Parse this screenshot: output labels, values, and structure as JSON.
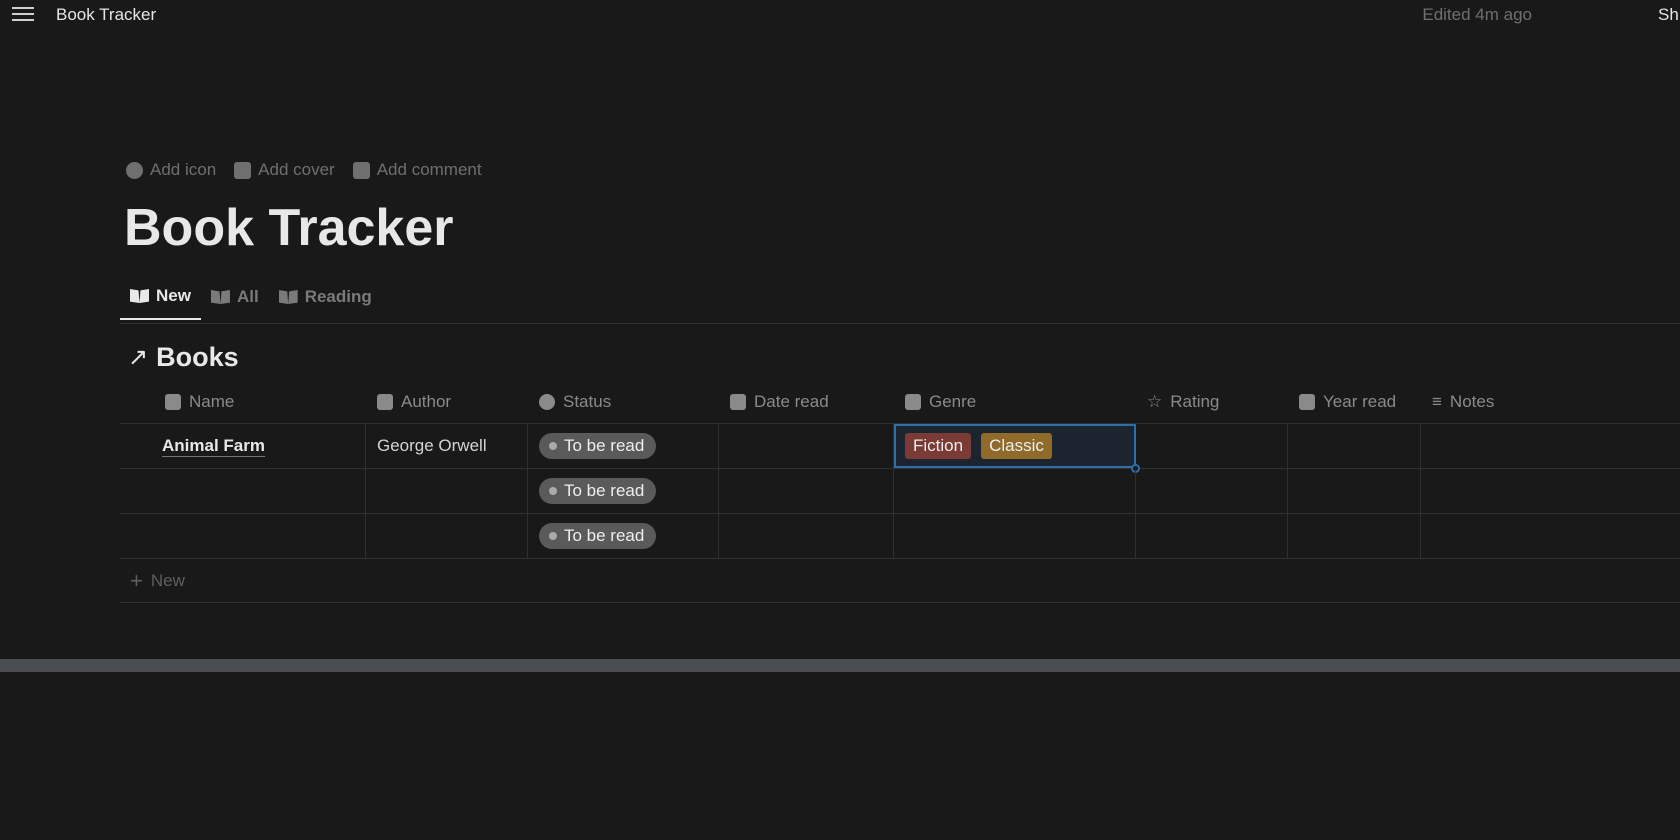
{
  "topbar": {
    "breadcrumb": "Book Tracker",
    "edited": "Edited 4m ago",
    "share": "Sh"
  },
  "page_actions": {
    "add_icon": "Add icon",
    "add_cover": "Add cover",
    "add_comment": "Add comment"
  },
  "title": "Book Tracker",
  "tabs": [
    {
      "label": "New",
      "active": true
    },
    {
      "label": "All"
    },
    {
      "label": "Reading"
    }
  ],
  "database": {
    "title": "Books",
    "arrow": "↗",
    "columns": [
      "Name",
      "Author",
      "Status",
      "Date read",
      "Genre",
      "Rating",
      "Year read",
      "Notes"
    ],
    "rows": [
      {
        "name": "Animal Farm",
        "author": "George Orwell",
        "status": "To be read",
        "genre": [
          {
            "label": "Fiction",
            "color": "#7a3a36"
          },
          {
            "label": "Classic",
            "color": "#8f6a2a"
          }
        ]
      },
      {
        "name": "",
        "author": "",
        "status": "To be read",
        "genre": []
      },
      {
        "name": "",
        "author": "",
        "status": "To be read",
        "genre": []
      }
    ],
    "new_label": "New"
  }
}
